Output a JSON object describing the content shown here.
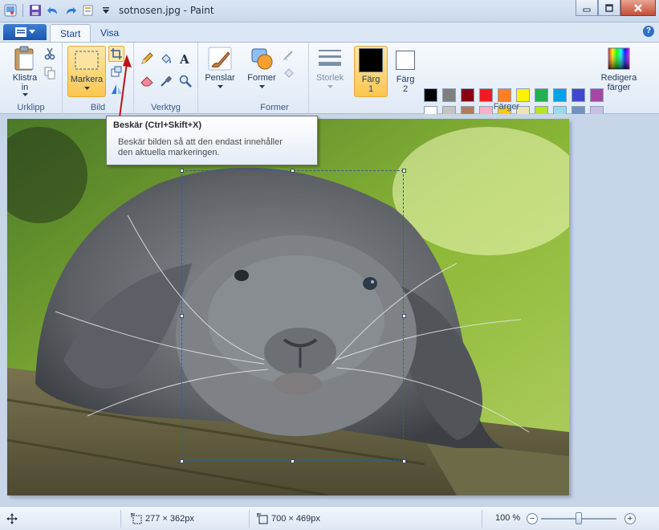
{
  "window": {
    "title": "sotnosen.jpg - Paint"
  },
  "tabs": [
    {
      "label": "Start",
      "active": true
    },
    {
      "label": "Visa",
      "active": false
    }
  ],
  "ribbon": {
    "clipboard": {
      "paste_line1": "Klistra",
      "paste_line2": "in",
      "group_label": "Urklipp"
    },
    "image": {
      "select_label": "Markera",
      "group_label": "Bild"
    },
    "tools": {
      "group_label": "Verktyg"
    },
    "brushes": {
      "label": "Penslar"
    },
    "shapes": {
      "label": "Former",
      "group_label": "Former"
    },
    "size": {
      "label": "Storlek"
    },
    "color1": {
      "line1": "Färg",
      "line2": "1",
      "color": "#000000"
    },
    "color2": {
      "line1": "Färg",
      "line2": "2",
      "color": "#ffffff"
    },
    "colors": {
      "group_label": "Färger",
      "row1": [
        "#000000",
        "#7f7f7f",
        "#880015",
        "#ed1c24",
        "#ff7f27",
        "#fff200",
        "#22b14c",
        "#00a2e8",
        "#3f48cc",
        "#a349a4"
      ],
      "row2": [
        "#ffffff",
        "#c3c3c3",
        "#b97a57",
        "#ffaec9",
        "#ffc90e",
        "#efe4b0",
        "#b5e61d",
        "#99d9ea",
        "#7092be",
        "#c8bfe7"
      ]
    },
    "edit_colors": {
      "line1": "Redigera",
      "line2": "färger"
    }
  },
  "tooltip": {
    "title": "Beskär (Ctrl+Skift+X)",
    "body_line1": "Beskär bilden så att den endast innehåller",
    "body_line2": "den aktuella markeringen."
  },
  "status": {
    "selection_size": "277 × 362px",
    "image_size": "700 × 469px",
    "zoom": "100 %",
    "zoom_fraction": 0.5
  }
}
